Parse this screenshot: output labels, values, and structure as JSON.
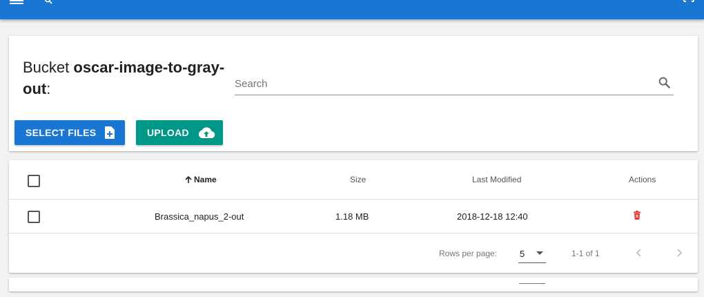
{
  "bucket": {
    "prefix": "Bucket ",
    "name": "oscar-image-to-gray-out",
    "suffix": ":"
  },
  "search": {
    "placeholder": "Search",
    "value": ""
  },
  "buttons": {
    "select_files": "SELECT FILES",
    "upload": "UPLOAD"
  },
  "table": {
    "columns": {
      "name": "Name",
      "size": "Size",
      "modified": "Last Modified",
      "actions": "Actions"
    },
    "rows": [
      {
        "name": "Brassica_napus_2-out",
        "size": "1.18 MB",
        "modified": "2018-12-18 12:40"
      }
    ],
    "footer": {
      "rows_per_page_label": "Rows per page:",
      "rows_per_page_value": "5",
      "range": "1-1 of 1"
    }
  },
  "colors": {
    "appbar": "#1976d2",
    "select_button": "#1976d2",
    "upload_button": "#009688",
    "delete_icon": "#e53935"
  },
  "icons": [
    "menu-icon",
    "search-icon",
    "fullscreen-icon",
    "file-add-icon",
    "cloud-upload-icon",
    "arrow-up-icon",
    "delete-icon",
    "dropdown-icon",
    "chevron-left-icon",
    "chevron-right-icon"
  ]
}
